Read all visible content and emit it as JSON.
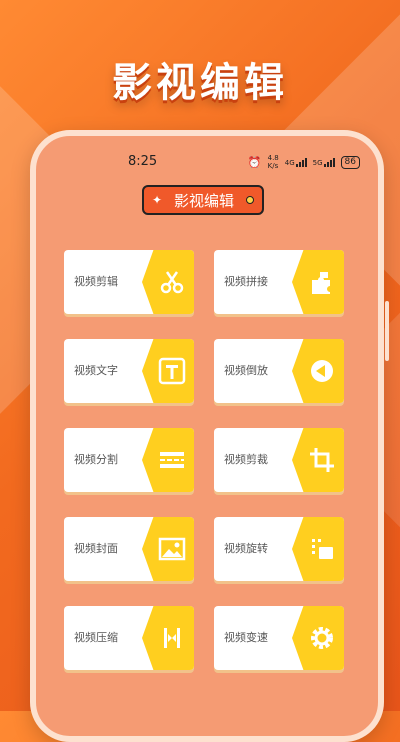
{
  "hero": {
    "title": "影视编辑"
  },
  "status": {
    "time": "8:25",
    "net_speed": "4.8",
    "net_unit": "K/s",
    "net_type1": "4G",
    "net_type2": "5G",
    "battery": "86"
  },
  "header": {
    "title": "影视编辑"
  },
  "tools": [
    {
      "label": "视频剪辑",
      "icon": "scissors-icon"
    },
    {
      "label": "视频拼接",
      "icon": "puzzle-icon"
    },
    {
      "label": "视频文字",
      "icon": "text-icon"
    },
    {
      "label": "视频倒放",
      "icon": "rewind-icon"
    },
    {
      "label": "视频分割",
      "icon": "split-icon"
    },
    {
      "label": "视频剪裁",
      "icon": "crop-icon"
    },
    {
      "label": "视频封面",
      "icon": "image-icon"
    },
    {
      "label": "视频旋转",
      "icon": "rotate-icon"
    },
    {
      "label": "视频压缩",
      "icon": "compress-icon"
    },
    {
      "label": "视频变速",
      "icon": "gear-icon"
    }
  ],
  "colors": {
    "background": "#f26a1f",
    "phone": "#f59b73",
    "accent": "#ffcf1f",
    "pill": "#f0592a"
  }
}
